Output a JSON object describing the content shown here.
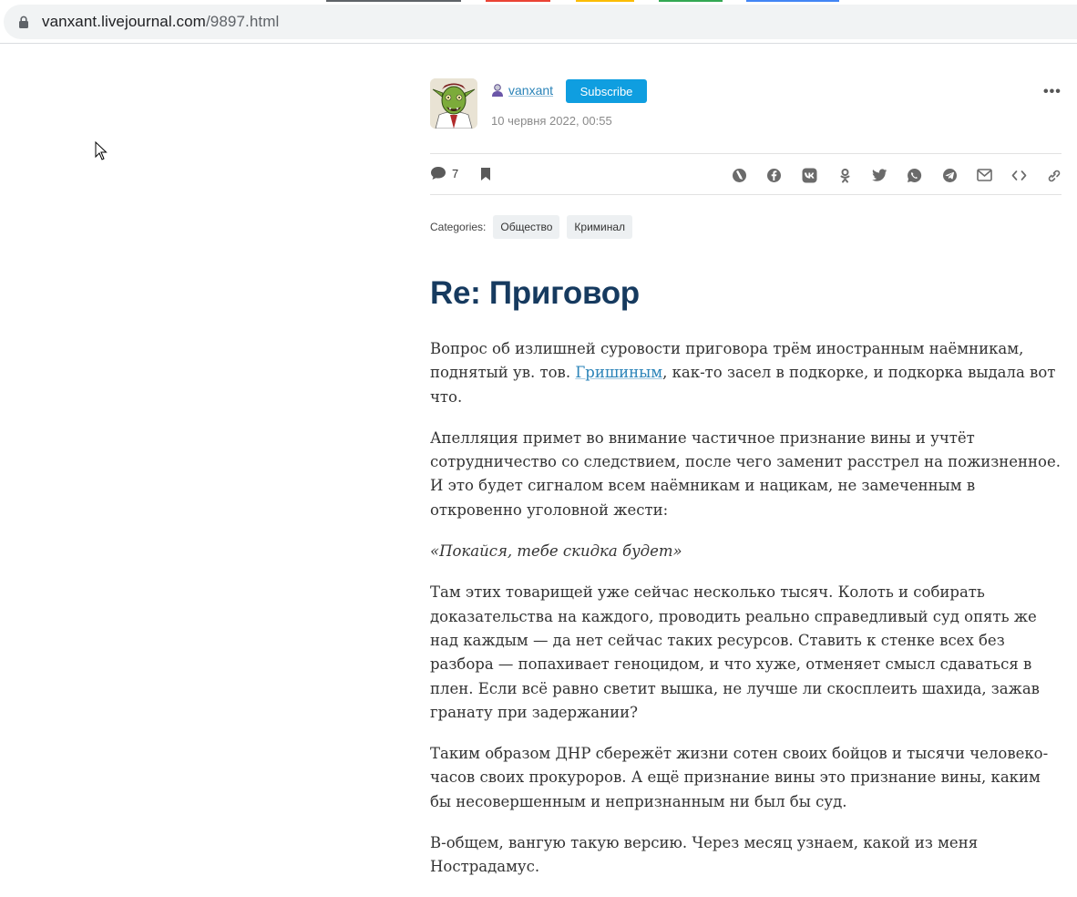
{
  "browser": {
    "url_host": "vanxant.livejournal.com",
    "url_path": "/9897.html"
  },
  "post": {
    "author": "vanxant",
    "subscribe_label": "Subscribe",
    "date": "10 червня 2022, 00:55",
    "more_label": "•••",
    "comment_count": "7",
    "categories_label": "Categories:",
    "categories": [
      "Общество",
      "Криминал"
    ],
    "title": "Re: Приговор",
    "p1_before": "Вопрос об излишней суровости приговора трём иностранным наёмникам, поднятый ув. тов. ",
    "p1_link": "Гришиным",
    "p1_after": ", как-то засел в подкорке, и подкорка выдала вот что.",
    "p2": "Апелляция примет во внимание частичное признание вины и учтёт сотрудничество со следствием, после чего заменит расстрел на пожизненное. И это будет сигналом всем наёмникам и нацикам, не замеченным в откровенно уголовной жести:",
    "p3": "«Покайся, тебе скидка будет»",
    "p4": "Там этих товарищей уже сейчас несколько тысяч. Колоть и собирать доказательства на каждого, проводить реально справедливый суд опять же над каждым — да нет сейчас таких ресурсов. Ставить к стенке всех без разбора — попахивает геноцидом, и что хуже, отменяет смысл сдаваться в плен. Если всё равно светит вышка, не лучше ли скосплеить шахида, зажав гранату при задержании?",
    "p5": "Таким образом ДНР сбережёт жизни сотен своих бойцов и тысячи человеко-часов своих прокуроров. А ещё признание вины это признание вины, каким бы несовершенным и непризнанным ни был бы суд.",
    "p6": "В-общем, вангую такую версию. Через месяц узнаем, какой из меня Нострадамус."
  },
  "share_icons": [
    "livejournal-repost-icon",
    "facebook-icon",
    "vk-icon",
    "odnoklassniki-icon",
    "twitter-icon",
    "whatsapp-icon",
    "telegram-icon",
    "email-icon",
    "embed-code-icon",
    "copy-link-icon"
  ],
  "colors": {
    "accent": "#0f9ee0",
    "title": "#163a5f",
    "link": "#2a83b8"
  }
}
